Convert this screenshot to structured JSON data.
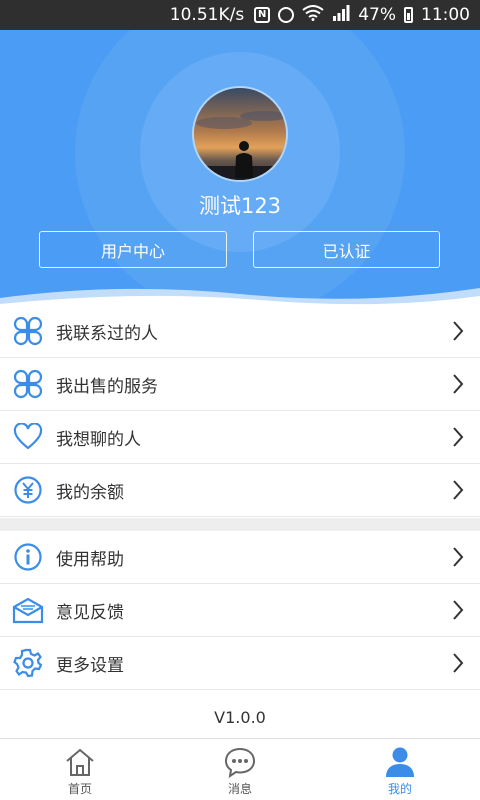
{
  "status_bar": {
    "speed": "10.51K/s",
    "battery": "47%",
    "time": "11:00"
  },
  "profile": {
    "username": "测试123",
    "user_center_label": "用户中心",
    "verified_label": "已认证"
  },
  "menu_group_1": [
    {
      "label": "我联系过的人",
      "icon": "four-petal-icon"
    },
    {
      "label": "我出售的服务",
      "icon": "four-petal-icon"
    },
    {
      "label": "我想聊的人",
      "icon": "heart-icon"
    },
    {
      "label": "我的余额",
      "icon": "yuan-icon"
    }
  ],
  "menu_group_2": [
    {
      "label": "使用帮助",
      "icon": "info-icon"
    },
    {
      "label": "意见反馈",
      "icon": "envelope-icon"
    },
    {
      "label": "更多设置",
      "icon": "gear-icon"
    }
  ],
  "version": "V1.0.0",
  "tabs": [
    {
      "label": "首页",
      "icon": "home-icon"
    },
    {
      "label": "消息",
      "icon": "chat-bubble-icon"
    },
    {
      "label": "我的",
      "icon": "person-icon"
    }
  ],
  "colors": {
    "header_blue": "#4a9cf4",
    "icon_blue": "#3b8de8",
    "active_tab": "#3b8de8"
  }
}
